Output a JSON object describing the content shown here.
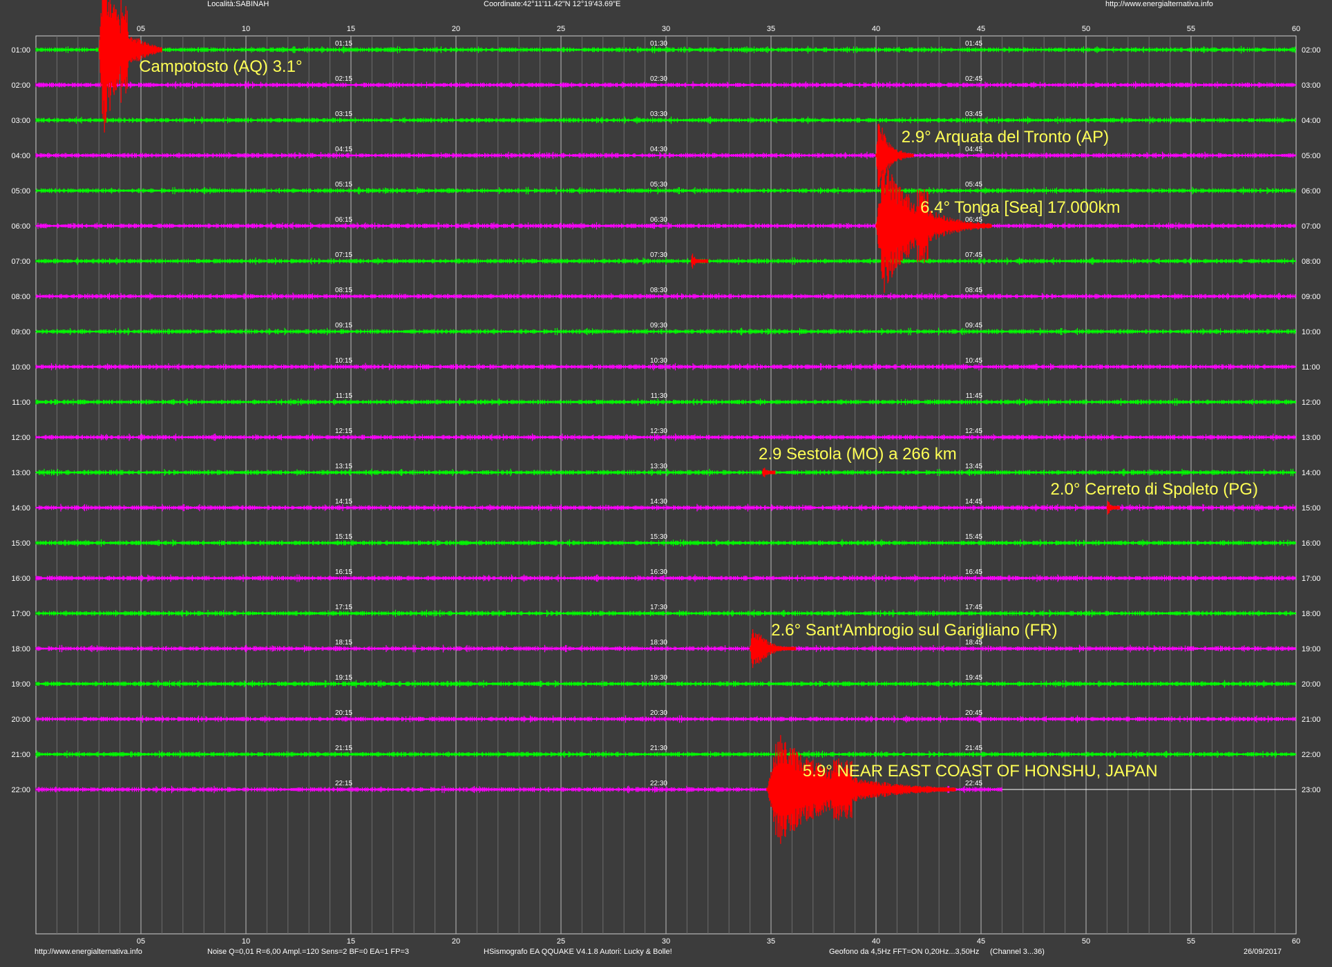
{
  "header": {
    "location": "Località:SABINAH",
    "coordinates": "Coordinate:42°11'11.42\"N  12°19'43.69\"E",
    "website": "http://www.energialternativa.info"
  },
  "footer": {
    "website": "http://www.energialternativa.info",
    "settings": "Noise Q=0,01 R=6,00 Ampl.=120 Sens=2 BF=0 EA=1 FP=3",
    "software": "HSismografo EA QQUAKE  V4.1.8  Autori: Lucky & Bolle!",
    "sensor": "Geofono da 4,5Hz FFT=ON 0,20Hz...3,50Hz",
    "channel": "(Channel 3...36)",
    "date": "26/09/2017"
  },
  "chart_data": {
    "type": "line",
    "subtype": "helicorder seismogram",
    "x_axis": {
      "range": [
        0,
        60
      ],
      "ticks": [
        "05",
        "10",
        "15",
        "20",
        "25",
        "30",
        "35",
        "40",
        "45",
        "50",
        "55",
        "60"
      ],
      "unit": "minutes",
      "grid": true
    },
    "colors": {
      "background": "#3c3c3c",
      "even_trace": "#00ff00",
      "odd_trace": "#ff00ff",
      "event": "#ff0000",
      "annotation": "#ffff55",
      "grid": "#d0d0d0"
    },
    "rows_left": [
      "01:00",
      "02:00",
      "03:00",
      "04:00",
      "05:00",
      "06:00",
      "07:00",
      "08:00",
      "09:00",
      "10:00",
      "11:00",
      "12:00",
      "13:00",
      "14:00",
      "15:00",
      "16:00",
      "17:00",
      "18:00",
      "19:00",
      "20:00",
      "21:00",
      "22:00"
    ],
    "rows_right": [
      "02:00",
      "03:00",
      "04:00",
      "05:00",
      "06:00",
      "07:00",
      "08:00",
      "09:00",
      "10:00",
      "11:00",
      "12:00",
      "13:00",
      "14:00",
      "15:00",
      "16:00",
      "17:00",
      "18:00",
      "19:00",
      "20:00",
      "21:00",
      "22:00",
      "23:00"
    ],
    "quarter_marks": [
      [
        "01:15",
        "01:30",
        "01:45"
      ],
      [
        "02:15",
        "02:30",
        "02:45"
      ],
      [
        "03:15",
        "03:30",
        "03:45"
      ],
      [
        "04:15",
        "04:30",
        "04:45"
      ],
      [
        "05:15",
        "05:30",
        "05:45"
      ],
      [
        "06:15",
        "06:30",
        "06:45"
      ],
      [
        "07:15",
        "07:30",
        "07:45"
      ],
      [
        "08:15",
        "08:30",
        "08:45"
      ],
      [
        "09:15",
        "09:30",
        "09:45"
      ],
      [
        "10:15",
        "10:30",
        "10:45"
      ],
      [
        "11:15",
        "11:30",
        "11:45"
      ],
      [
        "12:15",
        "12:30",
        "12:45"
      ],
      [
        "13:15",
        "13:30",
        "13:45"
      ],
      [
        "14:15",
        "14:30",
        "14:45"
      ],
      [
        "15:15",
        "15:30",
        "15:45"
      ],
      [
        "16:15",
        "16:30",
        "16:45"
      ],
      [
        "17:15",
        "17:30",
        "17:45"
      ],
      [
        "18:15",
        "18:30",
        "18:45"
      ],
      [
        "19:15",
        "19:30",
        "19:45"
      ],
      [
        "20:15",
        "20:30",
        "20:45"
      ],
      [
        "21:15",
        "21:30",
        "21:45"
      ],
      [
        "22:15",
        "22:30",
        "22:45"
      ]
    ],
    "trace_end_minute_last_row": 46,
    "events": [
      {
        "row": 0,
        "start_min": 3.0,
        "dur_min": 3.0,
        "amp": 1.0
      },
      {
        "row": 3,
        "start_min": 40.0,
        "dur_min": 1.8,
        "amp": 0.45
      },
      {
        "row": 5,
        "start_min": 40.0,
        "dur_min": 5.5,
        "amp": 0.75
      },
      {
        "row": 6,
        "start_min": 31.2,
        "dur_min": 0.8,
        "amp": 0.05
      },
      {
        "row": 12,
        "start_min": 34.6,
        "dur_min": 0.6,
        "amp": 0.04
      },
      {
        "row": 13,
        "start_min": 51.0,
        "dur_min": 0.6,
        "amp": 0.05
      },
      {
        "row": 17,
        "start_min": 34.0,
        "dur_min": 2.2,
        "amp": 0.25
      },
      {
        "row": 21,
        "start_min": 34.8,
        "dur_min": 9.0,
        "amp": 0.6
      }
    ],
    "annotations": [
      {
        "text": "Campotosto (AQ) 3.1°",
        "row": 0,
        "minute": 5.5
      },
      {
        "text": "2.9° Arquata del Tronto (AP)",
        "row": 2,
        "minute": 41.8
      },
      {
        "text": "6.4° Tonga [Sea] 17.000km",
        "row": 4,
        "minute": 42.7
      },
      {
        "text": "2.9 Sestola (MO) a 266 km",
        "row": 11,
        "minute": 35.0
      },
      {
        "text": "2.0° Cerreto di Spoleto (PG)",
        "row": 12,
        "minute": 48.9
      },
      {
        "text": "2.6° Sant'Ambrogio sul Garigliano (FR)",
        "row": 16,
        "minute": 35.6
      },
      {
        "text": "5.9° NEAR EAST COAST OF HONSHU, JAPAN",
        "row": 20,
        "minute": 37.1
      }
    ]
  }
}
